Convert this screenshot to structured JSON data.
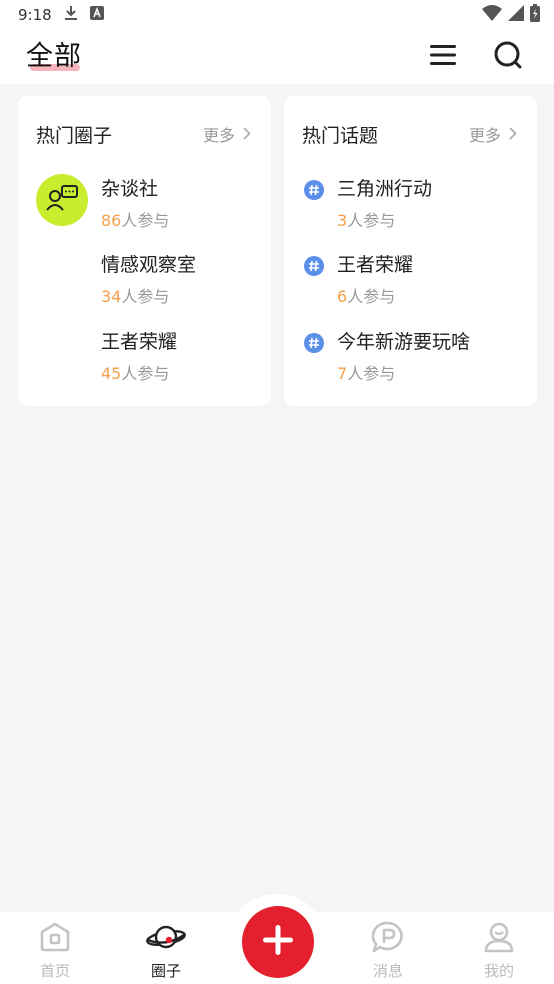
{
  "status_bar": {
    "time": "9:18"
  },
  "header": {
    "title": "全部"
  },
  "hot_circles": {
    "title": "热门圈子",
    "more": "更多",
    "items": [
      {
        "name": "杂谈社",
        "count": "86",
        "suffix": "人参与"
      },
      {
        "name": "情感观察室",
        "count": "34",
        "suffix": "人参与"
      },
      {
        "name": "王者荣耀",
        "count": "45",
        "suffix": "人参与"
      }
    ]
  },
  "hot_topics": {
    "title": "热门话题",
    "more": "更多",
    "items": [
      {
        "name": "三角洲行动",
        "count": "3",
        "suffix": "人参与"
      },
      {
        "name": "王者荣耀",
        "count": "6",
        "suffix": "人参与"
      },
      {
        "name": "今年新游要玩啥",
        "count": "7",
        "suffix": "人参与"
      }
    ]
  },
  "tabbar": {
    "home": "首页",
    "circles": "圈子",
    "messages": "消息",
    "me": "我的",
    "active": "circles"
  },
  "colors": {
    "accent": "#e5202e",
    "count": "#f5a04a",
    "avatar_bg": "#c9ec2e",
    "topic_icon": "#5b8fe8"
  },
  "icons": {
    "status": [
      "download-icon",
      "a-badge-icon",
      "wifi-icon",
      "signal-icon",
      "battery-icon"
    ],
    "header": [
      "menu-icon",
      "search-icon"
    ],
    "tabs": [
      "home-icon",
      "planet-icon",
      "plus-icon",
      "message-p-icon",
      "profile-icon"
    ]
  }
}
